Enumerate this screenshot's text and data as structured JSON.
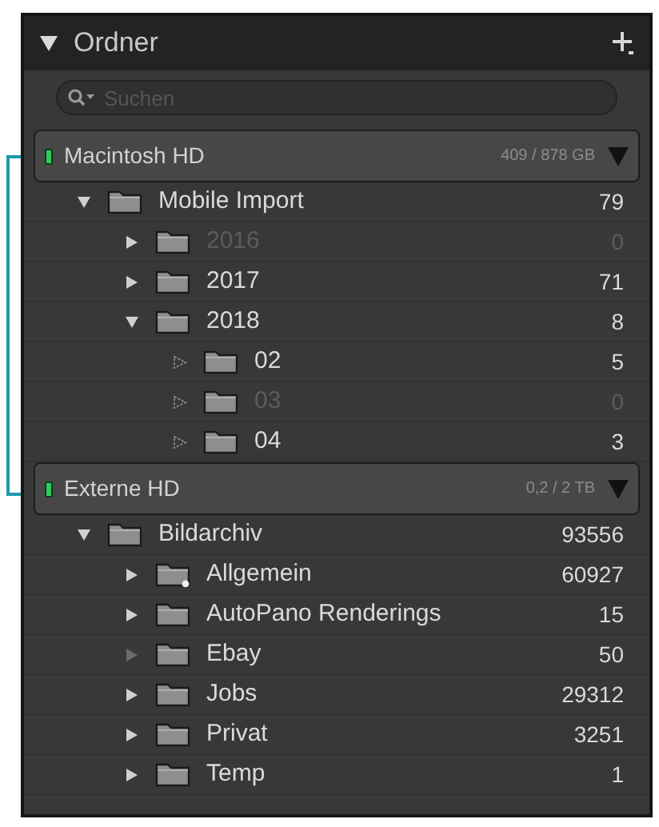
{
  "panel": {
    "title": "Ordner",
    "expanded": true
  },
  "search": {
    "placeholder": "Suchen"
  },
  "volumes": [
    {
      "name": "Macintosh HD",
      "usage": "409 / 878 GB",
      "online": true,
      "expanded": true,
      "folders": [
        {
          "name": "Mobile Import",
          "count": "79",
          "kind": "branch",
          "expanded": true,
          "dimmed": false,
          "flagged": false,
          "children": [
            {
              "name": "2016",
              "count": "0",
              "kind": "branch",
              "expanded": false,
              "dimmed": true,
              "flagged": false
            },
            {
              "name": "2017",
              "count": "71",
              "kind": "branch",
              "expanded": false,
              "dimmed": false,
              "flagged": false
            },
            {
              "name": "2018",
              "count": "8",
              "kind": "branch",
              "expanded": true,
              "dimmed": false,
              "flagged": false,
              "children": [
                {
                  "name": "02",
                  "count": "5",
                  "kind": "leaf",
                  "expanded": false,
                  "dimmed": false,
                  "flagged": false
                },
                {
                  "name": "03",
                  "count": "0",
                  "kind": "leaf",
                  "expanded": false,
                  "dimmed": true,
                  "flagged": false
                },
                {
                  "name": "04",
                  "count": "3",
                  "kind": "leaf",
                  "expanded": false,
                  "dimmed": false,
                  "flagged": false
                }
              ]
            }
          ]
        }
      ]
    },
    {
      "name": "Externe HD",
      "usage": "0,2 / 2 TB",
      "online": true,
      "expanded": true,
      "folders": [
        {
          "name": "Bildarchiv",
          "count": "93556",
          "kind": "branch",
          "expanded": true,
          "dimmed": false,
          "flagged": false,
          "children": [
            {
              "name": "Allgemein",
              "count": "60927",
              "kind": "branch",
              "expanded": false,
              "dimmed": false,
              "flagged": true
            },
            {
              "name": "AutoPano Renderings",
              "count": "15",
              "kind": "branch",
              "expanded": false,
              "dimmed": false,
              "flagged": false
            },
            {
              "name": "Ebay",
              "count": "50",
              "kind": "faded",
              "expanded": false,
              "dimmed": false,
              "flagged": false
            },
            {
              "name": "Jobs",
              "count": "29312",
              "kind": "branch",
              "expanded": false,
              "dimmed": false,
              "flagged": false
            },
            {
              "name": "Privat",
              "count": "3251",
              "kind": "branch",
              "expanded": false,
              "dimmed": false,
              "flagged": false
            },
            {
              "name": "Temp",
              "count": "1",
              "kind": "branch",
              "expanded": false,
              "dimmed": false,
              "flagged": false
            }
          ]
        }
      ]
    }
  ]
}
